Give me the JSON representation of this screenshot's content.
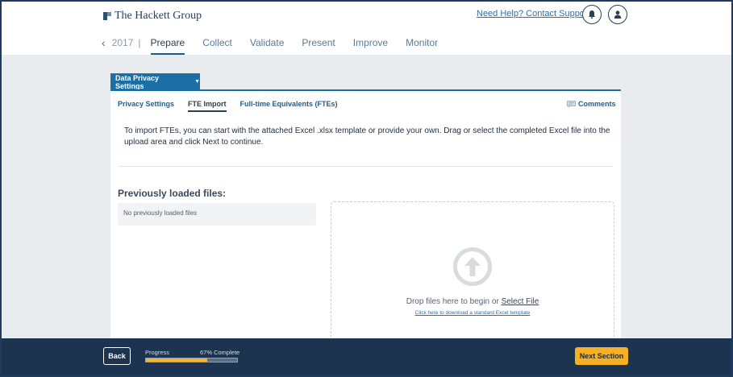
{
  "header": {
    "logo_text": "The Hackett Group",
    "help_link": "Need Help? Contact Support.",
    "icons": {
      "notifications": "bell-icon",
      "profile": "user-icon"
    }
  },
  "nav": {
    "year": "2017",
    "separator": "|",
    "tabs": [
      {
        "label": "Prepare",
        "active": true
      },
      {
        "label": "Collect"
      },
      {
        "label": "Validate"
      },
      {
        "label": "Present"
      },
      {
        "label": "Improve"
      },
      {
        "label": "Monitor"
      }
    ]
  },
  "section": {
    "title": "Data Privacy Settings",
    "subtabs": [
      {
        "label": "Privacy Settings"
      },
      {
        "label": "FTE Import",
        "active": true
      },
      {
        "label": "Full-time Equivalents (FTEs)"
      }
    ],
    "comments_label": "Comments",
    "instructions": "To import FTEs, you can start with the attached Excel .xlsx template or provide your own. Drag or select the completed Excel file into the upload area and click Next to continue.",
    "previous_title": "Previously loaded files:",
    "previous_empty": "No previously loaded files",
    "dropzone": {
      "text": "Drop files here to begin or",
      "select_link": "Select File",
      "download_link": "Click here to download a standard Excel template"
    }
  },
  "footer": {
    "back_label": "Back",
    "progress_label": "Progress",
    "progress_text": "67% Complete",
    "progress_value": 0.67,
    "next_label": "Next Section"
  },
  "colors": {
    "accent": "#1b6fa6",
    "footer_bg": "#1c3450",
    "next_button": "#f5b024",
    "progress_fill": "#f4b32a"
  }
}
